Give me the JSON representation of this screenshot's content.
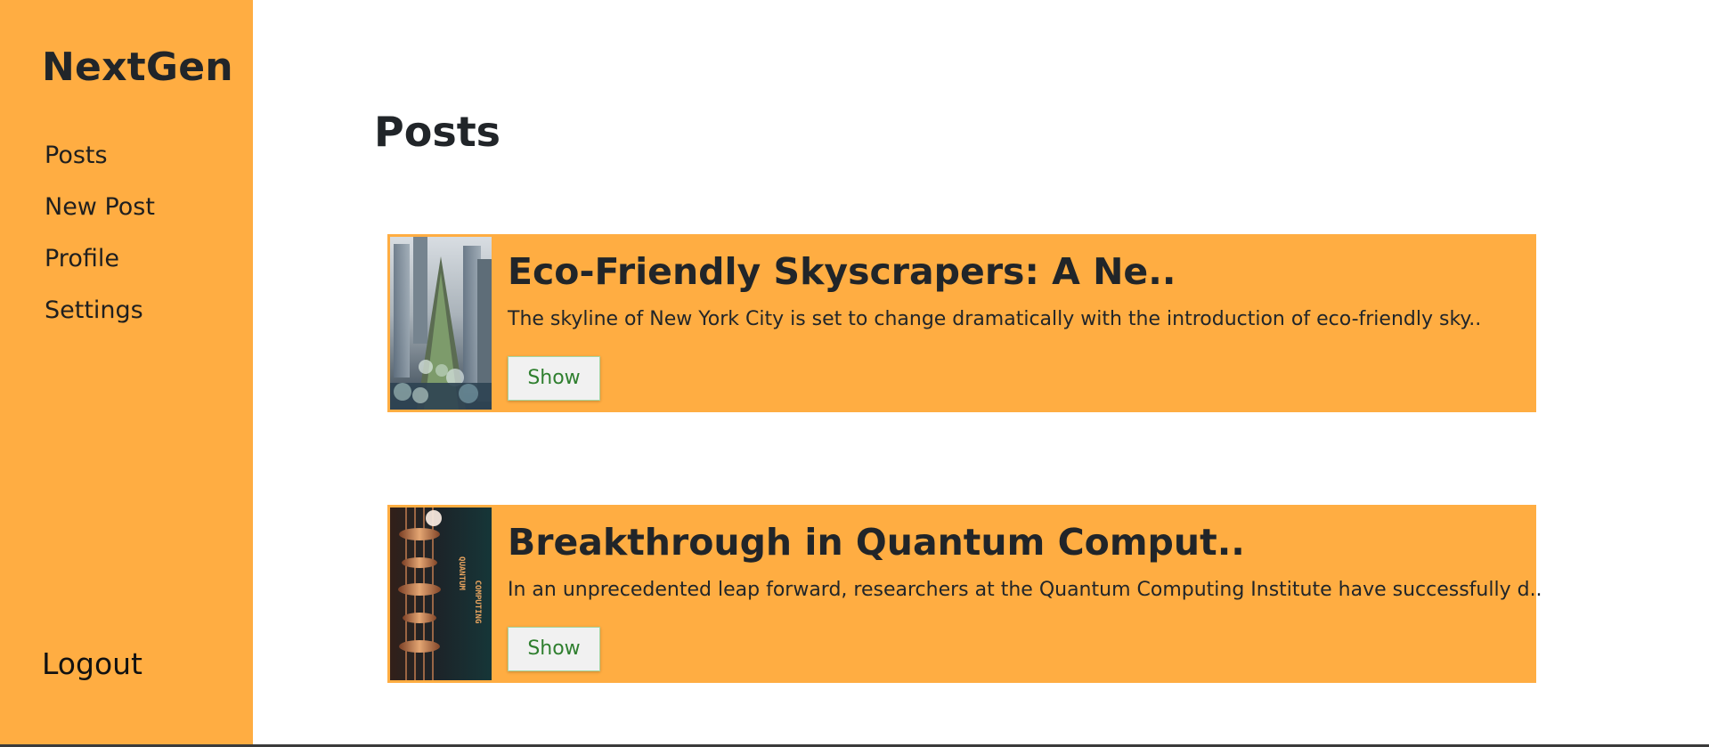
{
  "sidebar": {
    "brand": "NextGen",
    "items": [
      {
        "label": "Posts"
      },
      {
        "label": "New Post"
      },
      {
        "label": "Profile"
      },
      {
        "label": "Settings"
      }
    ],
    "logout_label": "Logout"
  },
  "main": {
    "title": "Posts",
    "posts": [
      {
        "title": "Eco-Friendly Skyscrapers: A Ne..",
        "excerpt": "The skyline of New York City is set to change dramatically with the introduction of eco-friendly sky..",
        "button_label": "Show",
        "thumbnail_icon": "skyscraper-image"
      },
      {
        "title": "Breakthrough in Quantum Comput..",
        "excerpt": "In an unprecedented leap forward, researchers at the Quantum Computing Institute have successfully d..",
        "button_label": "Show",
        "thumbnail_icon": "quantum-computer-image",
        "thumbnail_text": [
          "QUANTUM",
          "COMPUTING"
        ]
      }
    ]
  },
  "colors": {
    "accent": "#ffad42",
    "text": "#212529",
    "button_text": "#2f7f2f",
    "button_bg": "#f1f1f1",
    "page_bg": "#ffffff"
  }
}
